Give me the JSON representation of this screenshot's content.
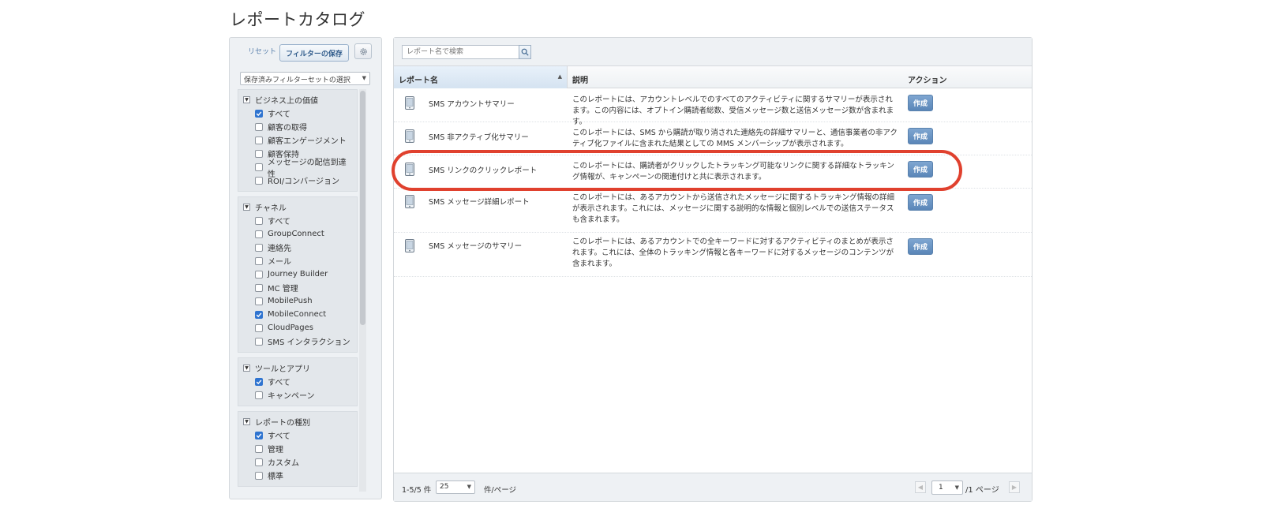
{
  "page": {
    "title": "レポートカタログ"
  },
  "filters": {
    "reset_label": "リセット",
    "save_label": "フィルターの保存",
    "saved_set_select": "保存済みフィルターセットの選択",
    "groups": [
      {
        "title": "ビジネス上の価値",
        "options": [
          {
            "label": "すべて",
            "checked": true
          },
          {
            "label": "顧客の取得",
            "checked": false
          },
          {
            "label": "顧客エンゲージメント",
            "checked": false
          },
          {
            "label": "顧客保持",
            "checked": false
          },
          {
            "label": "メッセージの配信到達性",
            "checked": false
          },
          {
            "label": "ROI/コンバージョン",
            "checked": false
          }
        ]
      },
      {
        "title": "チャネル",
        "options": [
          {
            "label": "すべて",
            "checked": false
          },
          {
            "label": "GroupConnect",
            "checked": false
          },
          {
            "label": "連絡先",
            "checked": false
          },
          {
            "label": "メール",
            "checked": false
          },
          {
            "label": "Journey Builder",
            "checked": false
          },
          {
            "label": "MC 管理",
            "checked": false
          },
          {
            "label": "MobilePush",
            "checked": false
          },
          {
            "label": "MobileConnect",
            "checked": true
          },
          {
            "label": "CloudPages",
            "checked": false
          },
          {
            "label": "SMS インタラクション",
            "checked": false
          }
        ]
      },
      {
        "title": "ツールとアプリ",
        "options": [
          {
            "label": "すべて",
            "checked": true
          },
          {
            "label": "キャンペーン",
            "checked": false
          }
        ]
      },
      {
        "title": "レポートの種別",
        "options": [
          {
            "label": "すべて",
            "checked": true
          },
          {
            "label": "管理",
            "checked": false
          },
          {
            "label": "カスタム",
            "checked": false
          },
          {
            "label": "標準",
            "checked": false
          }
        ]
      }
    ]
  },
  "search": {
    "placeholder": "レポート名で検索"
  },
  "table": {
    "columns": {
      "name": "レポート名",
      "description": "説明",
      "action": "アクション"
    },
    "create_label": "作成",
    "rows": [
      {
        "name": "SMS アカウントサマリー",
        "description": "このレポートには、アカウントレベルでのすべてのアクティビティに関するサマリーが表示されます。この内容には、オプトイン購読者総数、受信メッセージ数と送信メッセージ数が含まれます。"
      },
      {
        "name": "SMS 非アクティブ化サマリー",
        "description": "このレポートには、SMS から購読が取り消された連絡先の詳細サマリーと、通信事業者の非アクティブ化ファイルに含まれた結果としての MMS メンバーシップが表示されます。"
      },
      {
        "name": "SMS リンクのクリックレポート",
        "description": "このレポートには、購読者がクリックしたトラッキング可能なリンクに関する詳細なトラッキング情報が、キャンペーンの関連付けと共に表示されます。"
      },
      {
        "name": "SMS メッセージ詳細レポート",
        "description": "このレポートには、あるアカウントから送信されたメッセージに関するトラッキング情報の詳細が表示されます。これには、メッセージに関する説明的な情報と個別レベルでの送信ステータスも含まれます。"
      },
      {
        "name": "SMS メッセージのサマリー",
        "description": "このレポートには、あるアカウントでの全キーワードに対するアクティビティのまとめが表示されます。これには、全体のトラッキング情報と各キーワードに対するメッセージのコンテンツが含まれます。"
      }
    ],
    "highlighted_row": 2
  },
  "footer": {
    "count": "1-5/5 件",
    "per_page_value": "25",
    "per_page_label": "件/ページ",
    "page_value": "1",
    "page_total": "/1 ページ"
  },
  "colors": {
    "highlight_ring": "#e0412e",
    "accent": "#5a86b8",
    "checkbox_checked": "#2f74d0"
  }
}
